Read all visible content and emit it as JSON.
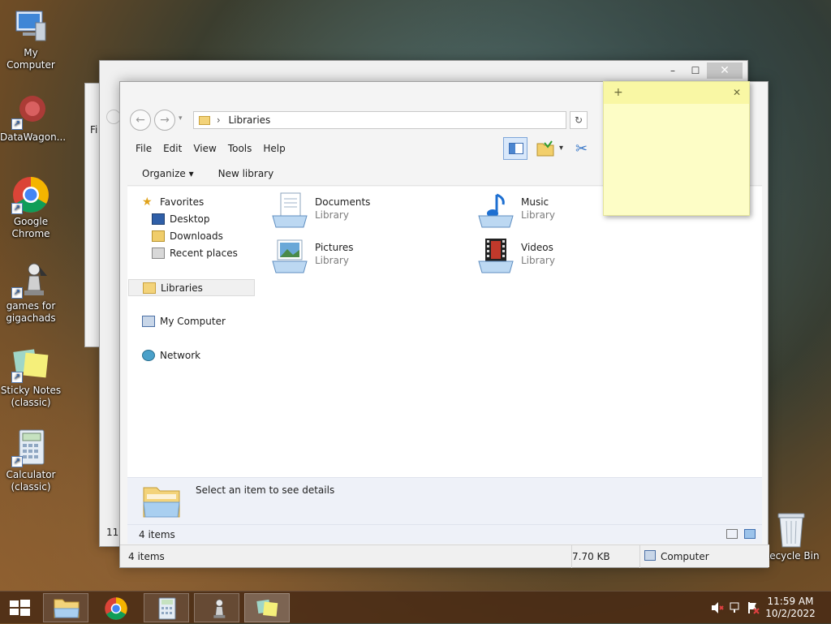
{
  "desktop": {
    "icons": [
      {
        "label": "My Computer"
      },
      {
        "label": "DataWagon..."
      },
      {
        "label": "Google Chrome"
      },
      {
        "label": "games for gigachads"
      },
      {
        "label": "Sticky Notes (classic)"
      },
      {
        "label": "Calculator (classic)"
      },
      {
        "label": "Recycle Bin"
      }
    ]
  },
  "background_window": {
    "text_fi": "Fi",
    "text_11": "11",
    "controls": {
      "minimize": "–",
      "maximize": "☐",
      "close": "✕"
    }
  },
  "explorer": {
    "address": "Libraries",
    "menu": [
      "File",
      "Edit",
      "View",
      "Tools",
      "Help"
    ],
    "commands": {
      "organize": "Organize ▾",
      "new_library": "New library"
    },
    "nav": {
      "favorites": "Favorites",
      "desktop": "Desktop",
      "downloads": "Downloads",
      "recent": "Recent places",
      "libraries": "Libraries",
      "computer": "My Computer",
      "network": "Network"
    },
    "libraries": [
      {
        "name": "Documents",
        "sub": "Library"
      },
      {
        "name": "Music",
        "sub": "Library"
      },
      {
        "name": "Pictures",
        "sub": "Library"
      },
      {
        "name": "Videos",
        "sub": "Library"
      }
    ],
    "details_text": "Select an item to see details",
    "inner_status": "4 items",
    "outer_status": {
      "items": "4 items",
      "size": "7.70 KB",
      "location": "Computer"
    }
  },
  "sticky": {
    "add": "+",
    "close": "✕"
  },
  "taskbar": {
    "time": "11:59 AM",
    "date": "10/2/2022"
  },
  "colors": {
    "accent": "#2f63b0",
    "sticky": "#fdfdc6",
    "taskbar": "#46281480"
  }
}
